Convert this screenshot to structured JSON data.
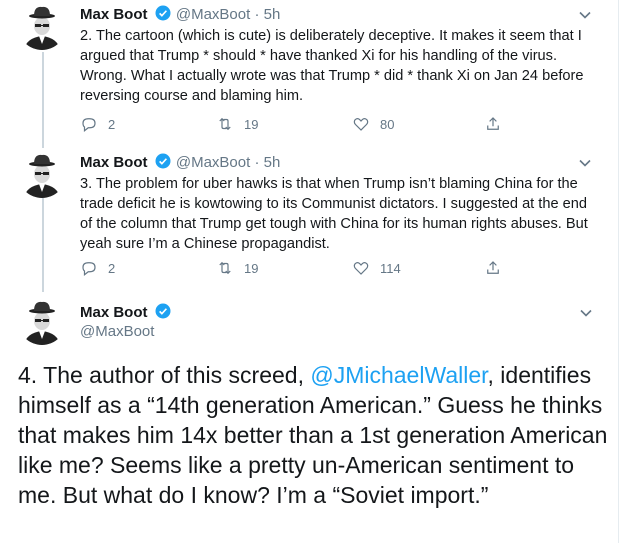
{
  "tweets": [
    {
      "name": "Max Boot",
      "handle": "@MaxBoot",
      "dot": "·",
      "time": "5h",
      "text": "2. The cartoon (which is cute) is deliberately deceptive. It makes it seem that I argued that Trump * should * have thanked Xi for his handling of the virus. Wrong. What I actually wrote was that Trump * did * thank Xi on Jan 24 before reversing course and blaming him.",
      "replies": "2",
      "retweets": "19",
      "likes": "80"
    },
    {
      "name": "Max Boot",
      "handle": "@MaxBoot",
      "dot": "·",
      "time": "5h",
      "text": "3. The problem for uber hawks is that when Trump isn’t blaming China for the trade deficit he is kowtowing to its Communist dictators. I suggested at the end of the column that Trump get tough with China for its human rights abuses. But yeah sure I’m a Chinese propagandist.",
      "replies": "2",
      "retweets": "19",
      "likes": "114"
    }
  ],
  "main_tweet": {
    "name": "Max Boot",
    "handle": "@MaxBoot",
    "text_before": "4. The author of this screed, ",
    "mention": "@JMichaelWaller",
    "text_after": ", identifies himself as a “14th generation American.” Guess he thinks that makes him 14x better than a 1st generation American like me? Seems like a pretty un-American sentiment to me. But what do I know? I’m a “Soviet import.”"
  },
  "colors": {
    "verified": "#1da1f2",
    "mention": "#1da1f2",
    "secondary_text": "#657786",
    "thread_line": "#ccd6dd"
  },
  "icons": [
    "reply-icon",
    "retweet-icon",
    "like-icon",
    "share-icon",
    "chevron-down-icon",
    "verified-badge-icon"
  ]
}
